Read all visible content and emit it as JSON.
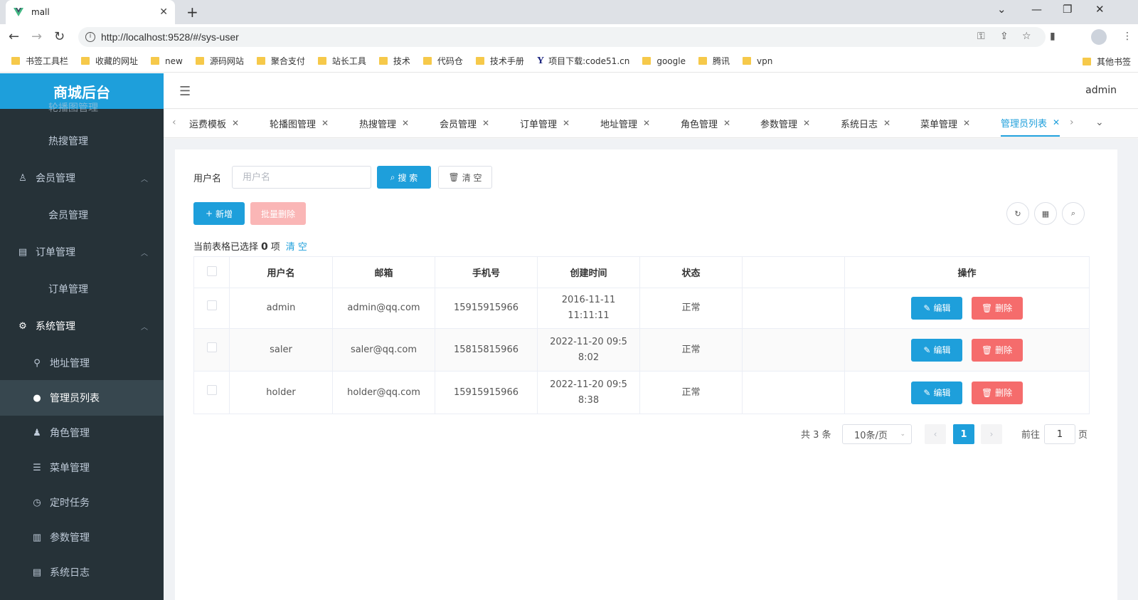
{
  "browser": {
    "tab_title": "mall",
    "url": "http://localhost:9528/#/sys-user",
    "bookmarks": [
      "书签工具栏",
      "收藏的网址",
      "new",
      "源码网站",
      "聚合支付",
      "站长工具",
      "技术",
      "代码仓",
      "技术手册",
      "项目下载:code51.cn",
      "google",
      "腾讯",
      "vpn"
    ],
    "other_bookmarks": "其他书签"
  },
  "app": {
    "logo": "商城后台",
    "user": "admin"
  },
  "sidebar": {
    "items": [
      {
        "label": "轮播图管理"
      },
      {
        "label": "热搜管理"
      },
      {
        "label": "会员管理"
      },
      {
        "label": "会员管理"
      },
      {
        "label": "订单管理"
      },
      {
        "label": "订单管理"
      },
      {
        "label": "系统管理"
      },
      {
        "label": "地址管理"
      },
      {
        "label": "管理员列表"
      },
      {
        "label": "角色管理"
      },
      {
        "label": "菜单管理"
      },
      {
        "label": "定时任务"
      },
      {
        "label": "参数管理"
      },
      {
        "label": "系统日志"
      }
    ]
  },
  "tags": [
    "运费模板",
    "轮播图管理",
    "热搜管理",
    "会员管理",
    "订单管理",
    "地址管理",
    "角色管理",
    "参数管理",
    "系统日志",
    "菜单管理",
    "管理员列表"
  ],
  "search": {
    "label": "用户名",
    "placeholder": "用户名",
    "search_btn": "搜 索",
    "clear_btn": "清 空"
  },
  "toolbar": {
    "add": "新增",
    "batch_delete": "批量删除"
  },
  "selection": {
    "prefix": "当前表格已选择",
    "count": "0",
    "suffix": "项",
    "clear": "清 空"
  },
  "table": {
    "headers": [
      "用户名",
      "邮箱",
      "手机号",
      "创建时间",
      "状态",
      "",
      "操作"
    ],
    "rows": [
      {
        "username": "admin",
        "email": "admin@qq.com",
        "phone": "15915915966",
        "created": "2016-11-11 11:11:11",
        "status": "正常"
      },
      {
        "username": "saler",
        "email": "saler@qq.com",
        "phone": "15815815966",
        "created": "2022-11-20 09:58:02",
        "status": "正常"
      },
      {
        "username": "holder",
        "email": "holder@qq.com",
        "phone": "15915915966",
        "created": "2022-11-20 09:58:38",
        "status": "正常"
      }
    ],
    "edit_label": "编辑",
    "delete_label": "删除"
  },
  "pagination": {
    "total": "共 3 条",
    "page_size": "10条/页",
    "current": "1",
    "goto_prefix": "前往",
    "goto_value": "1",
    "goto_suffix": "页"
  },
  "colors": {
    "primary": "#1e9fdb",
    "danger": "#f56c6c",
    "sidebar": "#263238"
  }
}
